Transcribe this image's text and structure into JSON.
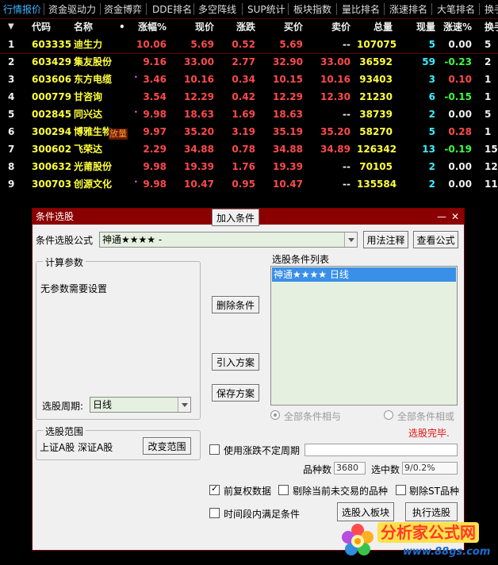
{
  "tabs": [
    "行情报价",
    "资金驱动力",
    "资金博弈",
    "DDE排名",
    "多空阵线",
    "SUP统计",
    "板块指数",
    "量比排名",
    "涨速排名",
    "大笔排名",
    "换手"
  ],
  "table": {
    "headers": [
      "代码",
      "名称",
      "•",
      "涨幅%",
      "现价",
      "涨跌",
      "买价",
      "卖价",
      "总量",
      "现量",
      "涨速%",
      "换手"
    ],
    "rows": [
      {
        "idx": "1",
        "code": "603335",
        "name": "迪生力",
        "mark": "",
        "chg_pct": "10.06",
        "price": "5.69",
        "chg": "0.52",
        "bid": "5.69",
        "ask": "--",
        "vol": "107075",
        "cur_vol": "5",
        "speed": "0.00",
        "turn": "5"
      },
      {
        "idx": "2",
        "code": "603429",
        "name": "集友股份",
        "mark": "",
        "chg_pct": "9.16",
        "price": "33.00",
        "chg": "2.77",
        "bid": "32.90",
        "ask": "33.00",
        "vol": "36592",
        "cur_vol": "59",
        "speed": "-0.23",
        "turn": "2"
      },
      {
        "idx": "3",
        "code": "603606",
        "name": "东方电缆",
        "mark": "•",
        "chg_pct": "3.46",
        "price": "10.16",
        "chg": "0.34",
        "bid": "10.15",
        "ask": "10.16",
        "vol": "93403",
        "cur_vol": "3",
        "speed": "0.10",
        "turn": "1"
      },
      {
        "idx": "4",
        "code": "000779",
        "name": "甘咨询",
        "mark": "",
        "chg_pct": "3.54",
        "price": "12.29",
        "chg": "0.42",
        "bid": "12.29",
        "ask": "12.30",
        "vol": "21230",
        "cur_vol": "6",
        "speed": "-0.15",
        "turn": "1"
      },
      {
        "idx": "5",
        "code": "002845",
        "name": "同兴达",
        "mark": "•",
        "chg_pct": "9.98",
        "price": "18.63",
        "chg": "1.69",
        "bid": "18.63",
        "ask": "--",
        "vol": "38739",
        "cur_vol": "2",
        "speed": "0.00",
        "turn": "5"
      },
      {
        "idx": "6",
        "code": "300294",
        "name": "博雅生物",
        "mark": "放量",
        "chg_pct": "9.97",
        "price": "35.20",
        "chg": "3.19",
        "bid": "35.19",
        "ask": "35.20",
        "vol": "58270",
        "cur_vol": "5",
        "speed": "0.28",
        "turn": "1"
      },
      {
        "idx": "7",
        "code": "300602",
        "name": "飞荣达",
        "mark": "",
        "chg_pct": "2.29",
        "price": "34.88",
        "chg": "0.78",
        "bid": "34.88",
        "ask": "34.89",
        "vol": "126342",
        "cur_vol": "13",
        "speed": "-0.19",
        "turn": "15"
      },
      {
        "idx": "8",
        "code": "300632",
        "name": "光莆股份",
        "mark": "",
        "chg_pct": "9.98",
        "price": "19.39",
        "chg": "1.76",
        "bid": "19.39",
        "ask": "--",
        "vol": "70105",
        "cur_vol": "2",
        "speed": "0.00",
        "turn": "12"
      },
      {
        "idx": "9",
        "code": "300703",
        "name": "创源文化",
        "mark": "•",
        "chg_pct": "9.98",
        "price": "10.47",
        "chg": "0.95",
        "bid": "10.47",
        "ask": "--",
        "vol": "135584",
        "cur_vol": "2",
        "speed": "0.00",
        "turn": "11"
      }
    ]
  },
  "dialog": {
    "title": "条件选股",
    "minimize": "—",
    "close": "✕",
    "formula_label": "条件选股公式",
    "formula_value": "神通★★★★ -",
    "btn_usage": "用法注释",
    "btn_view": "查看公式",
    "params_group": "计算参数",
    "params_text": "无参数需要设置",
    "period_label": "选股周期:",
    "period_value": "日线",
    "btn_add": "加入条件",
    "btn_delete": "删除条件",
    "btn_import": "引入方案",
    "btn_save": "保存方案",
    "list_title": "选股条件列表",
    "list_item": "神通★★★★   日线",
    "radio_and": "全部条件相与",
    "radio_or": "全部条件相或",
    "status": "选股完毕.",
    "range_group": "选股范围",
    "range_text": "上证A股 深证A股",
    "btn_range": "改变范围",
    "chk_period": "使用涨跌不定周期",
    "count_label": "品种数",
    "count_value": "3680",
    "selected_label": "选中数",
    "selected_value": "9/0.2%",
    "chk_fq": "前复权数据",
    "chk_exclude_suspend": "剔除当前未交易的品种",
    "chk_exclude_st": "剔除ST品种",
    "chk_time": "时间段内满足条件",
    "btn_to_block": "选股入板块",
    "btn_execute": "执行选股"
  },
  "watermark": {
    "brand": "分析家公式网",
    "url": "www.88gs.com"
  },
  "colors": {
    "dialog_title_bg": "#8b0000",
    "list_selection": "#3a8fe8",
    "up_red": "#ff4a4a",
    "down_green": "#3cff3c",
    "name_yellow": "#ffff3c",
    "volume_cyan": "#3cf0ff",
    "active_tab": "#39b7ff"
  }
}
